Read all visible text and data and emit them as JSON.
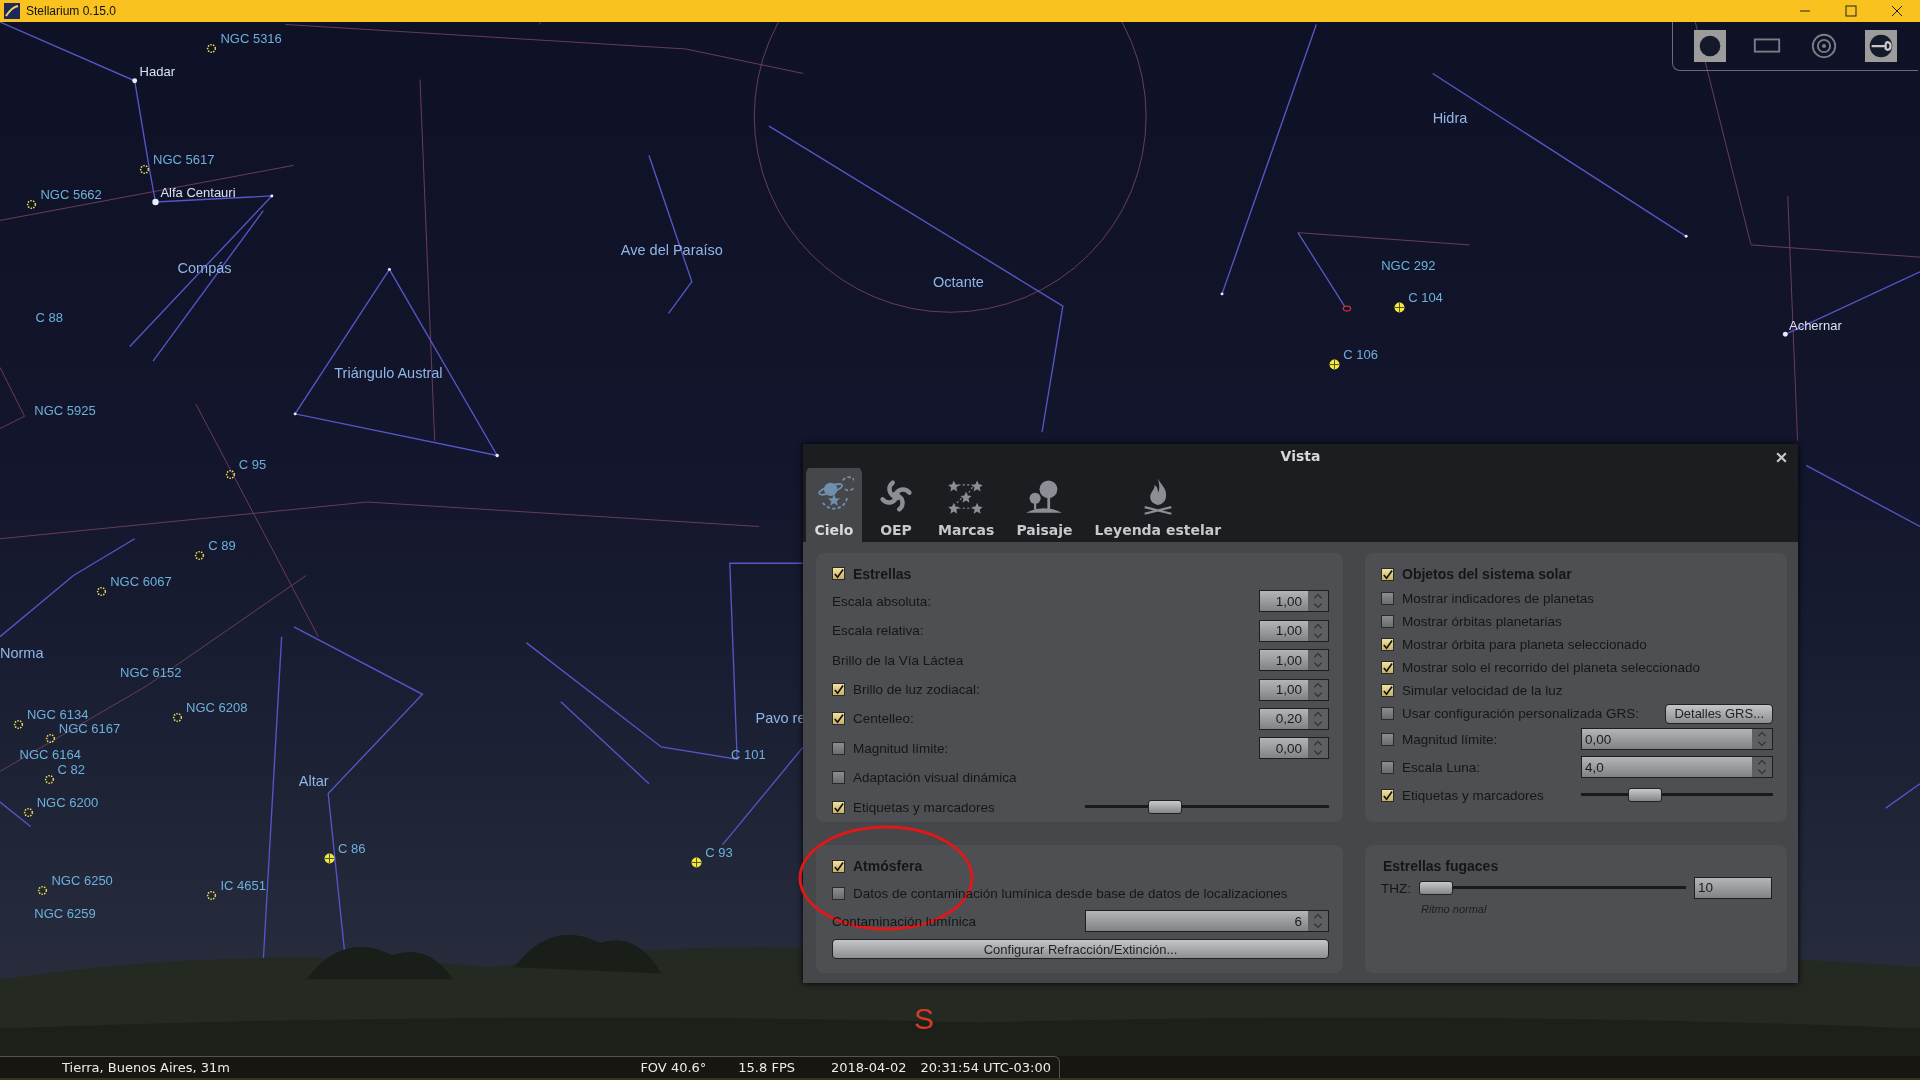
{
  "window": {
    "title": "Stellarium 0.15.0"
  },
  "toolbar": [
    {
      "kind": "night",
      "on": true
    },
    {
      "kind": "fullscreen",
      "on": false
    },
    {
      "kind": "target",
      "on": false
    },
    {
      "kind": "wrench",
      "on": true
    }
  ],
  "sky": {
    "labels": [
      {
        "text": "NGC 5316",
        "kind": "cluster"
      },
      {
        "text": "Hadar",
        "kind": "star"
      },
      {
        "text": "NGC 5617",
        "kind": "cluster"
      },
      {
        "text": "Alfa Centauri",
        "kind": "star"
      },
      {
        "text": "NGC 5662",
        "kind": "cluster"
      },
      {
        "text": "Compás",
        "kind": "constellation"
      },
      {
        "text": "C 88",
        "kind": "label"
      },
      {
        "text": "Triángulo Austral",
        "kind": "constellation"
      },
      {
        "text": "NGC 5925",
        "kind": "label"
      },
      {
        "text": "C 95",
        "kind": "cluster"
      },
      {
        "text": "C 89",
        "kind": "cluster"
      },
      {
        "text": "NGC 6067",
        "kind": "cluster"
      },
      {
        "text": "Norma",
        "kind": "constellation"
      },
      {
        "text": "NGC 6152",
        "kind": "label"
      },
      {
        "text": "NGC 6134",
        "kind": "cluster"
      },
      {
        "text": "NGC 6167",
        "kind": "cluster"
      },
      {
        "text": "NGC 6208",
        "kind": "cluster"
      },
      {
        "text": "NGC 6164",
        "kind": "label"
      },
      {
        "text": "C 82",
        "kind": "cluster"
      },
      {
        "text": "NGC 6200",
        "kind": "cluster"
      },
      {
        "text": "Altar",
        "kind": "constellation"
      },
      {
        "text": "C 86",
        "kind": "globular"
      },
      {
        "text": "NGC 6250",
        "kind": "cluster"
      },
      {
        "text": "IC 4651",
        "kind": "cluster"
      },
      {
        "text": "NGC 6259",
        "kind": "label"
      },
      {
        "text": "Ave del Paraíso",
        "kind": "constellation"
      },
      {
        "text": "Octante",
        "kind": "constellation"
      },
      {
        "text": "Pavo re",
        "kind": "constellation"
      },
      {
        "text": "C 101",
        "kind": "label"
      },
      {
        "text": "C 93",
        "kind": "globular"
      },
      {
        "text": "Hidra",
        "kind": "constellation"
      },
      {
        "text": "NGC 292",
        "kind": "label"
      },
      {
        "text": "C 104",
        "kind": "globular"
      },
      {
        "text": "C 106",
        "kind": "globular"
      },
      {
        "text": "Achernar",
        "kind": "star"
      }
    ],
    "direction": "S"
  },
  "dialog": {
    "title": "Vista",
    "tabs": [
      {
        "label": "Cielo",
        "kind": "sky",
        "selected": true
      },
      {
        "label": "OEP",
        "kind": "galaxy",
        "selected": false
      },
      {
        "label": "Marcas",
        "kind": "marks",
        "selected": false
      },
      {
        "label": "Paisaje",
        "kind": "landscape",
        "selected": false
      },
      {
        "label": "Leyenda estelar",
        "kind": "fire",
        "selected": false
      }
    ],
    "groups": [
      {
        "title": "Estrellas",
        "checked": true,
        "rows": [
          {
            "kind": "spin",
            "label": "Escala absoluta:",
            "value": "1,00"
          },
          {
            "kind": "spin",
            "label": "Escala relativa:",
            "value": "1,00"
          },
          {
            "kind": "spin",
            "label": "Brillo de la Vía Láctea",
            "value": "1,00"
          },
          {
            "kind": "spin",
            "label": "Brillo de luz zodiacal:",
            "checked": true,
            "value": "1,00"
          },
          {
            "kind": "spin",
            "label": "Centelleo:",
            "checked": true,
            "value": "0,20"
          },
          {
            "kind": "spin",
            "label": "Magnitud límite:",
            "checked": false,
            "value": "0,00"
          },
          {
            "kind": "check",
            "label": "Adaptación visual dinámica",
            "checked": false
          },
          {
            "kind": "slider",
            "label": "Etiquetas y marcadores",
            "checked": true,
            "level": 0.3
          }
        ]
      },
      {
        "title": "Objetos del sistema solar",
        "checked": true,
        "rows": [
          {
            "kind": "check",
            "label": "Mostrar indicadores de planetas",
            "checked": false
          },
          {
            "kind": "check",
            "label": "Mostrar órbitas planetarias",
            "checked": false
          },
          {
            "kind": "check",
            "label": "Mostrar órbita para planeta seleccionado",
            "checked": true
          },
          {
            "kind": "check",
            "label": "Mostrar solo el recorrido del planeta seleccionado",
            "checked": true
          },
          {
            "kind": "check",
            "label": "Simular velocidad de la luz",
            "checked": true
          },
          {
            "kind": "button",
            "label": "Usar configuración personalizada GRS:",
            "checked": false,
            "button": "Detalles GRS..."
          },
          {
            "kind": "widespin",
            "label": "Magnitud límite:",
            "checked": false,
            "value": "0,00"
          },
          {
            "kind": "widespin",
            "label": "Escala Luna:",
            "checked": false,
            "value": "4,0"
          },
          {
            "kind": "slider",
            "label": "Etiquetas y marcadores",
            "checked": true,
            "level": 0.3
          }
        ]
      },
      {
        "title": "Atmósfera",
        "checked": true,
        "rows": [
          {
            "kind": "check",
            "label": "Datos de contaminación lumínica desde base de datos de localizaciones",
            "checked": false
          },
          {
            "kind": "valuespin",
            "label": "Contaminación lumínica",
            "value": "6"
          },
          {
            "kind": "fullbutton",
            "button": "Configurar Refracción/Extinción..."
          }
        ]
      },
      {
        "title": "Estrellas fugaces",
        "rows": [
          {
            "kind": "rate",
            "label": "THZ:",
            "level": 0,
            "value": "10",
            "note": "Ritmo normal"
          }
        ]
      }
    ]
  },
  "status_bar": {
    "location": "Tierra, Buenos Aires, 31m",
    "fov": "FOV 40.6°",
    "fps": "15.8 FPS",
    "date": "2018-04-02",
    "time": "20:31:54 UTC-03:00"
  }
}
